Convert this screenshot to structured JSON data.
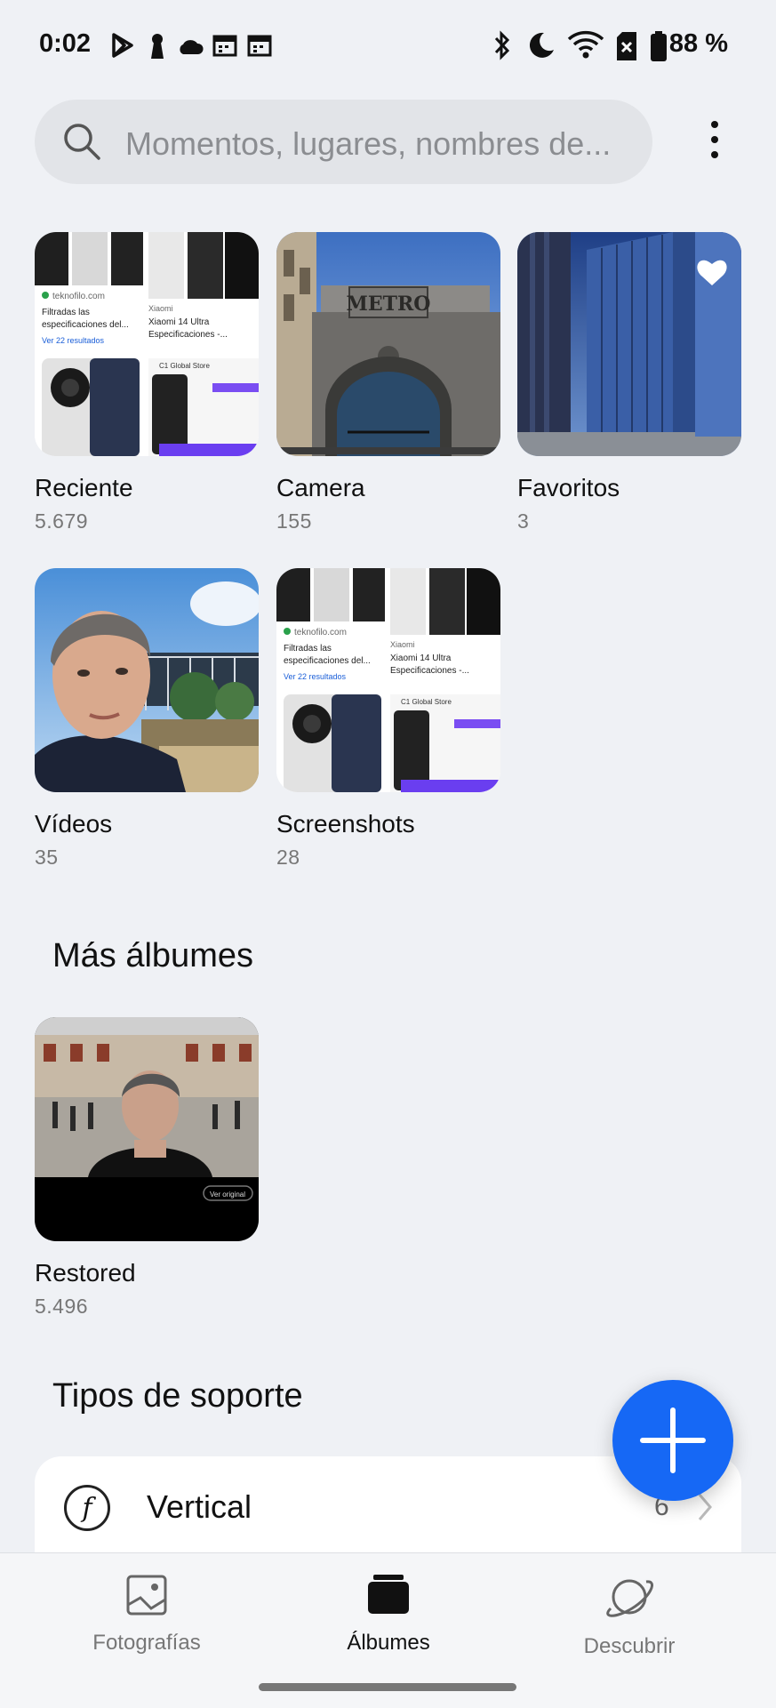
{
  "status_bar": {
    "time": "0:02",
    "left_icons": [
      "play-store-icon",
      "keyhole-icon",
      "cloud-icon",
      "calendar-icon",
      "calendar-icon"
    ],
    "right_icons": [
      "bluetooth-icon",
      "do-not-disturb-moon-icon",
      "wifi-icon",
      "no-sim-icon",
      "battery-icon"
    ],
    "battery": "88 %"
  },
  "search": {
    "placeholder": "Momentos, lugares, nombres de..."
  },
  "albums": [
    {
      "title": "Reciente",
      "count": "5.679"
    },
    {
      "title": "Camera",
      "count": "155"
    },
    {
      "title": "Favoritos",
      "count": "3"
    },
    {
      "title": "Vídeos",
      "count": "35"
    },
    {
      "title": "Screenshots",
      "count": "28"
    }
  ],
  "screenshot_thumb": {
    "source": "teknofilo.com",
    "text1": "Filtradas las",
    "text2": "especificaciones del...",
    "link": "Ver 22 resultados",
    "brand": "Xiaomi",
    "product1": "Xiaomi 14 Ultra",
    "product2": "Especificaciones -...",
    "store": "C1 Global Store"
  },
  "metro_sign": "METRO",
  "more_albums": {
    "title": "Más álbumes",
    "albums": [
      {
        "title": "Restored",
        "count": "5.496",
        "badge": "Ver original"
      }
    ]
  },
  "media_types": {
    "title": "Tipos de soporte",
    "items": [
      {
        "label": "Vertical",
        "count": "6",
        "icon": "aperture-f-icon"
      }
    ]
  },
  "bottom_nav": [
    {
      "label": "Fotografías",
      "icon": "photo-icon",
      "active": false
    },
    {
      "label": "Álbumes",
      "icon": "album-icon",
      "active": true
    },
    {
      "label": "Descubrir",
      "icon": "planet-icon",
      "active": false
    }
  ],
  "colors": {
    "background": "#eff1f5",
    "accent": "#1668f5",
    "search_bg": "#e2e4e8"
  }
}
